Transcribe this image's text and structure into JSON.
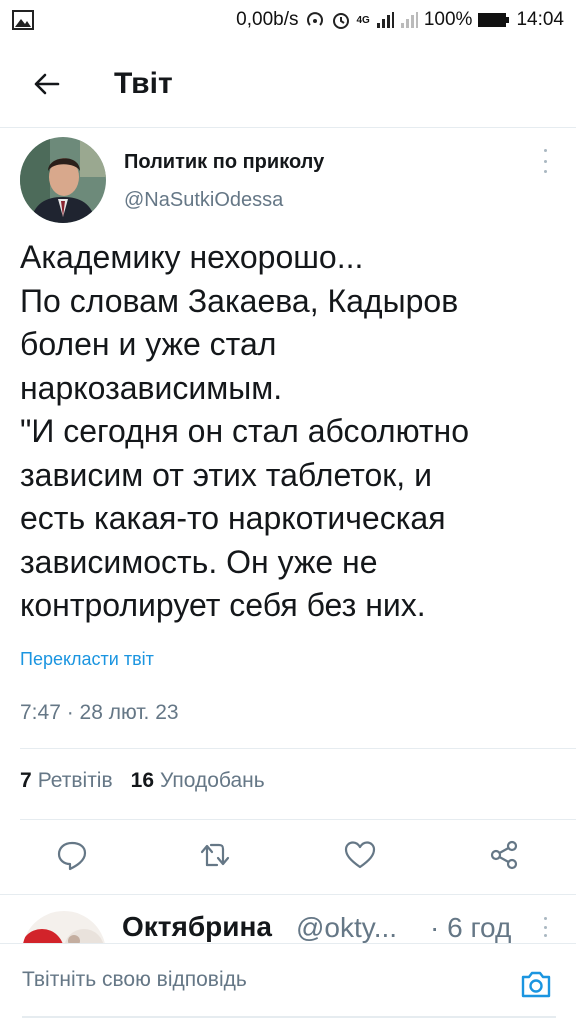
{
  "status_bar": {
    "net_speed": "0,00b/s",
    "network_type": "4G",
    "battery": "100%",
    "time": "14:04"
  },
  "header": {
    "title": "Твіт"
  },
  "tweet": {
    "author_name": "Политик по приколу",
    "author_handle": "@NaSutkiOdessa",
    "text_lines": [
      "Академику нехорошо...",
      "По словам Закаева, Кадыров",
      "болен и уже стал",
      "наркозависимым.",
      "\"И сегодня он стал абсолютно",
      "зависим от этих таблеток, и",
      "есть какая-то наркотическая",
      "зависимость. Он уже не",
      "контролирует себя без них."
    ],
    "translate_label": "Перекласти твіт",
    "timestamp": "7:47 · 28 лют. 23",
    "retweets_count": "7",
    "retweets_label": "Ретвітів",
    "likes_count": "16",
    "likes_label": "Уподобань"
  },
  "reply_preview": {
    "name": "Октябрина",
    "handle": "@okty...",
    "time": "· 6 год"
  },
  "compose": {
    "placeholder": "Твітніть свою відповідь"
  },
  "colors": {
    "accent": "#1b95e0",
    "secondary_text": "#657786",
    "primary_text": "#14171a",
    "divider": "#e6ecf0"
  },
  "icons": {
    "gallery": "image-icon",
    "back": "arrow-left-icon",
    "reply": "comment-icon",
    "retweet": "retweet-icon",
    "like": "heart-icon",
    "share": "share-icon",
    "camera": "camera-icon"
  }
}
